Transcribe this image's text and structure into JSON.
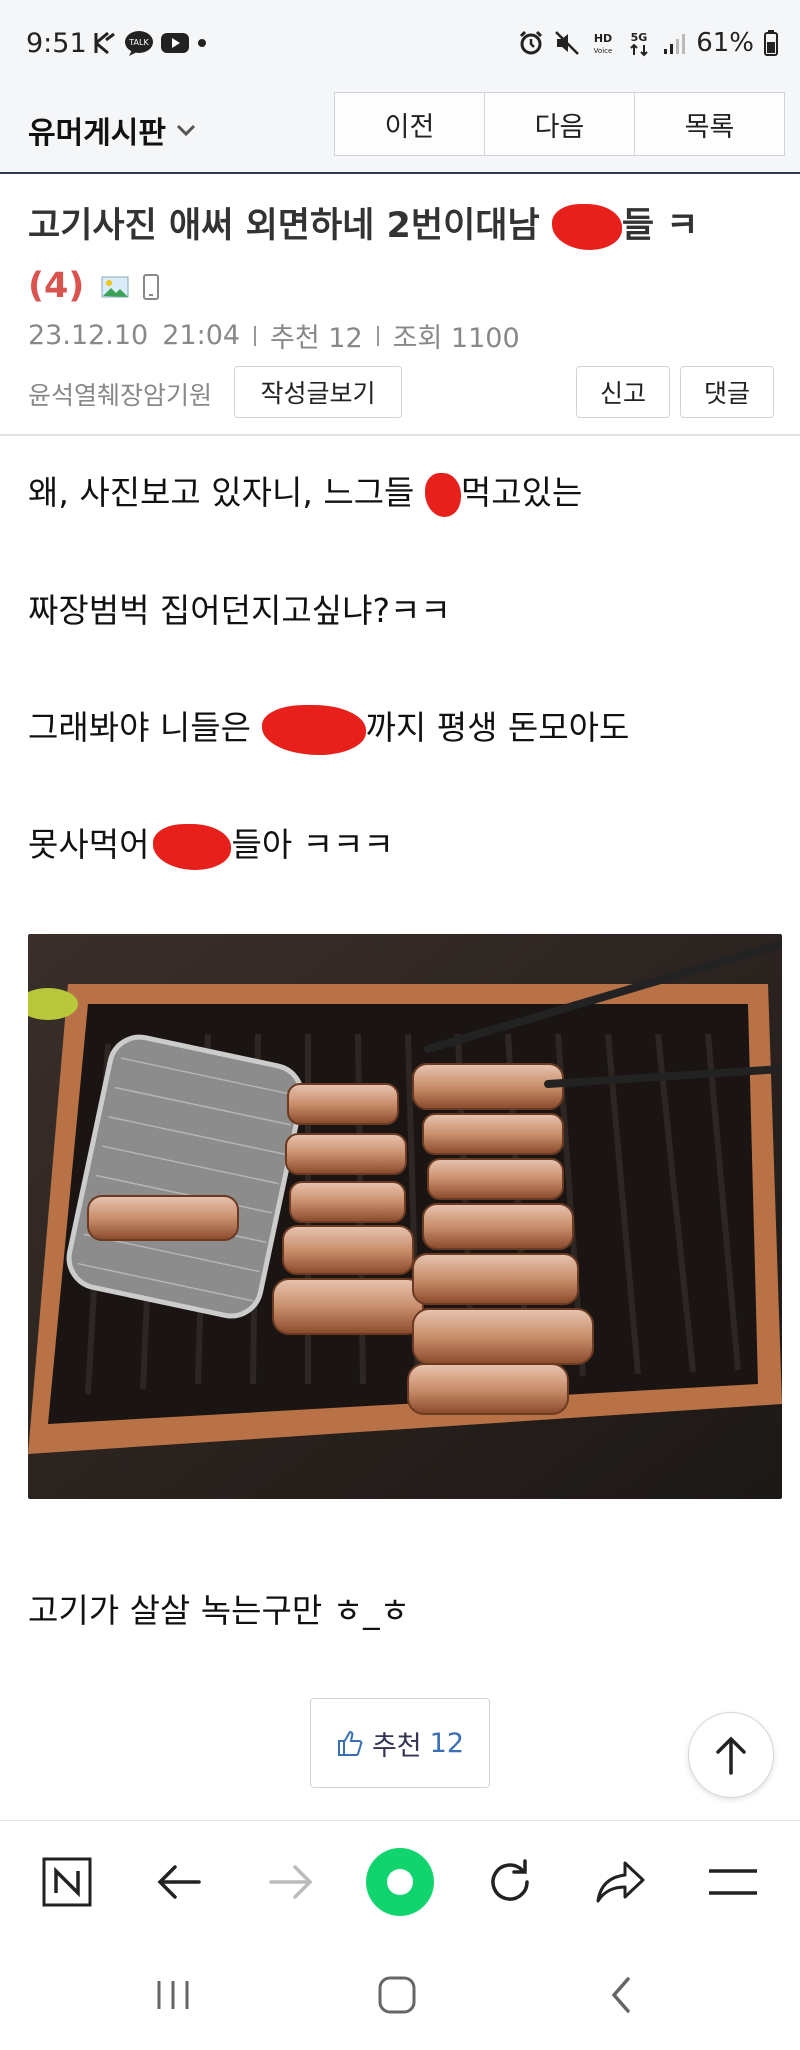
{
  "status_bar": {
    "time": "9:51",
    "battery": "61%",
    "left_icons": [
      "k-icon",
      "talk-icon",
      "youtube-icon",
      "dot-icon"
    ],
    "right_icons": [
      "alarm-icon",
      "mute-icon",
      "hd-voice-icon",
      "5g-icon",
      "signal-icon",
      "battery-icon"
    ]
  },
  "header": {
    "board_name": "유머게시판",
    "nav": {
      "prev": "이전",
      "next": "다음",
      "list": "목록"
    }
  },
  "article": {
    "title_part1": "고기사진 애써 외면하네 2번이대남",
    "title_part2": "들 ㅋ",
    "comment_count": "(4)",
    "date": "23.12.10",
    "time": "21:04",
    "recommend_label": "추천 12",
    "views_label": "조회 1100",
    "author": "윤석열췌장암기원",
    "author_posts_button": "작성글보기",
    "report_button": "신고",
    "comment_button": "댓글"
  },
  "content": {
    "line1_a": "왜, 사진보고 있자니, 느그들",
    "line1_b": "먹고있는",
    "line2": "짜장범벅 집어던지고싶냐?ㅋㅋ",
    "line3_a": "그래봐야 니들은",
    "line3_b": "까지 평생 돈모아도",
    "line4_a": "못사먹어",
    "line4_b": "들아 ㅋㅋㅋ",
    "photo_name": "grilled-pork-belly-photo",
    "line5": "고기가 살살 녹는구만 ㅎ_ㅎ"
  },
  "recommend": {
    "label": "추천",
    "count": "12"
  },
  "colors": {
    "accent_red": "#d9534f",
    "redaction": "#e8201b",
    "toolbar_green": "#12d46e",
    "link_blue": "#3a6fb5"
  }
}
